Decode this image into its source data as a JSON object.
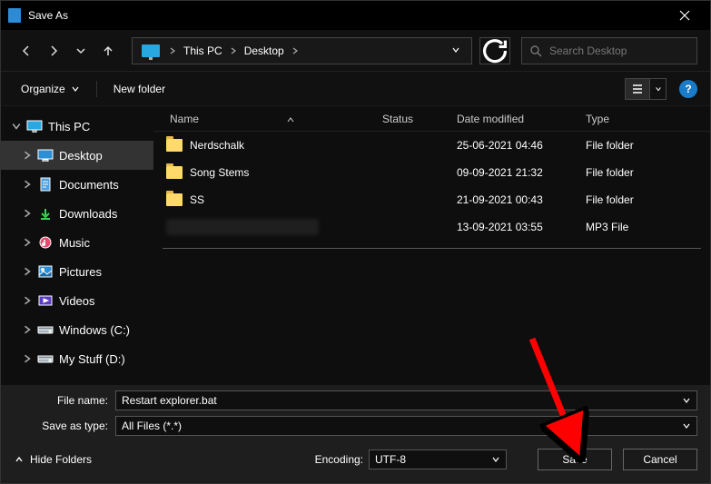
{
  "title": "Save As",
  "breadcrumb": {
    "root": "This PC",
    "folder": "Desktop"
  },
  "search": {
    "placeholder": "Search Desktop"
  },
  "toolbar": {
    "organize": "Organize",
    "newfolder": "New folder"
  },
  "help": "?",
  "tree": [
    {
      "label": "This PC",
      "icon": "pc",
      "level": 1,
      "expanded": true
    },
    {
      "label": "Desktop",
      "icon": "desktop",
      "level": 2,
      "selected": true
    },
    {
      "label": "Documents",
      "icon": "documents",
      "level": 2
    },
    {
      "label": "Downloads",
      "icon": "downloads",
      "level": 2
    },
    {
      "label": "Music",
      "icon": "music",
      "level": 2
    },
    {
      "label": "Pictures",
      "icon": "pictures",
      "level": 2
    },
    {
      "label": "Videos",
      "icon": "videos",
      "level": 2
    },
    {
      "label": "Windows (C:)",
      "icon": "drive",
      "level": 2
    },
    {
      "label": "My Stuff (D:)",
      "icon": "drive",
      "level": 2
    }
  ],
  "cols": {
    "name": "Name",
    "status": "Status",
    "date": "Date modified",
    "type": "Type"
  },
  "files": [
    {
      "name": "Nerdschalk",
      "date": "25-06-2021 04:46",
      "type": "File folder",
      "icon": "folder"
    },
    {
      "name": "Song Stems",
      "date": "09-09-2021 21:32",
      "type": "File folder",
      "icon": "folder"
    },
    {
      "name": "SS",
      "date": "21-09-2021 00:43",
      "type": "File folder",
      "icon": "folder"
    },
    {
      "name": "",
      "date": "13-09-2021 03:55",
      "type": "MP3 File",
      "icon": "redacted"
    }
  ],
  "form": {
    "filename_label": "File name:",
    "filename_value": "Restart explorer.bat",
    "savetype_label": "Save as type:",
    "savetype_value": "All Files  (*.*)"
  },
  "footer": {
    "hide": "Hide Folders",
    "encoding_label": "Encoding:",
    "encoding_value": "UTF-8",
    "save": "Save",
    "cancel": "Cancel"
  }
}
